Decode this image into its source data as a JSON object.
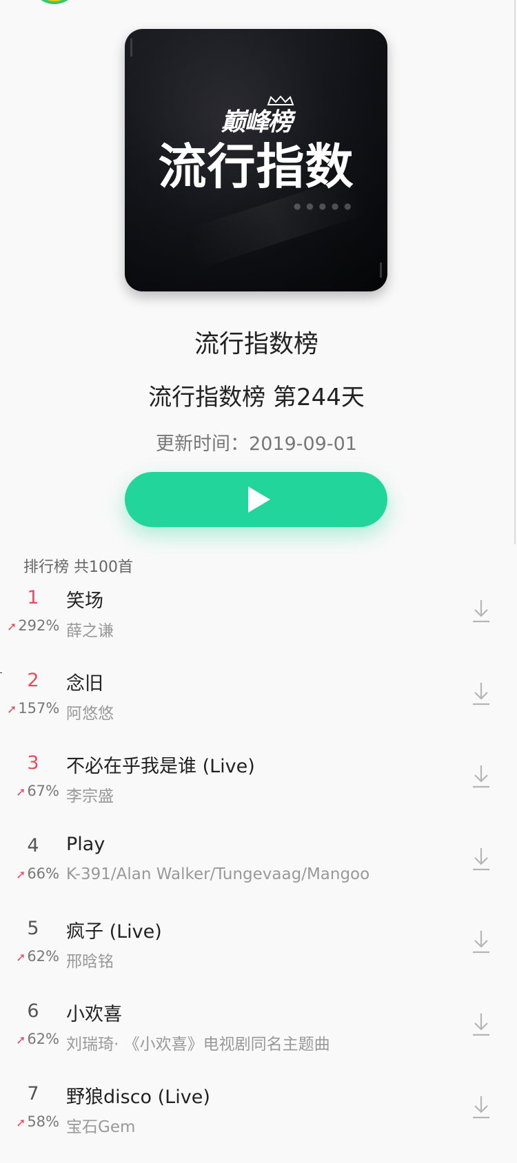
{
  "cover": {
    "subtitle": "巅峰榜",
    "main": "流行指数"
  },
  "header": {
    "title": "流行指数榜",
    "subtitle": "流行指数榜 第244天",
    "update_time": "更新时间：2019-09-01"
  },
  "play_button": {
    "icon": "play-icon"
  },
  "list": {
    "header": "排行榜 共100首",
    "items": [
      {
        "rank": "1",
        "change": "292%",
        "title": "笑场",
        "artist": "薛之谦"
      },
      {
        "rank": "2",
        "change": "157%",
        "title": "念旧",
        "artist": "阿悠悠"
      },
      {
        "rank": "3",
        "change": "67%",
        "title": "不必在乎我是谁 (Live)",
        "artist": "李宗盛"
      },
      {
        "rank": "4",
        "change": "66%",
        "title": "Play",
        "artist": "K-391/Alan Walker/Tungevaag/Mangoo"
      },
      {
        "rank": "5",
        "change": "62%",
        "title": "疯子 (Live)",
        "artist": "邢晗铭"
      },
      {
        "rank": "6",
        "change": "62%",
        "title": "小欢喜",
        "artist": "刘瑞琦· 《小欢喜》电视剧同名主题曲"
      },
      {
        "rank": "7",
        "change": "58%",
        "title": "野狼disco (Live)",
        "artist": "宝石Gem"
      }
    ]
  },
  "colors": {
    "accent": "#22d59b",
    "rank_top": "#e84b60",
    "trend_up": "#e84b60"
  }
}
